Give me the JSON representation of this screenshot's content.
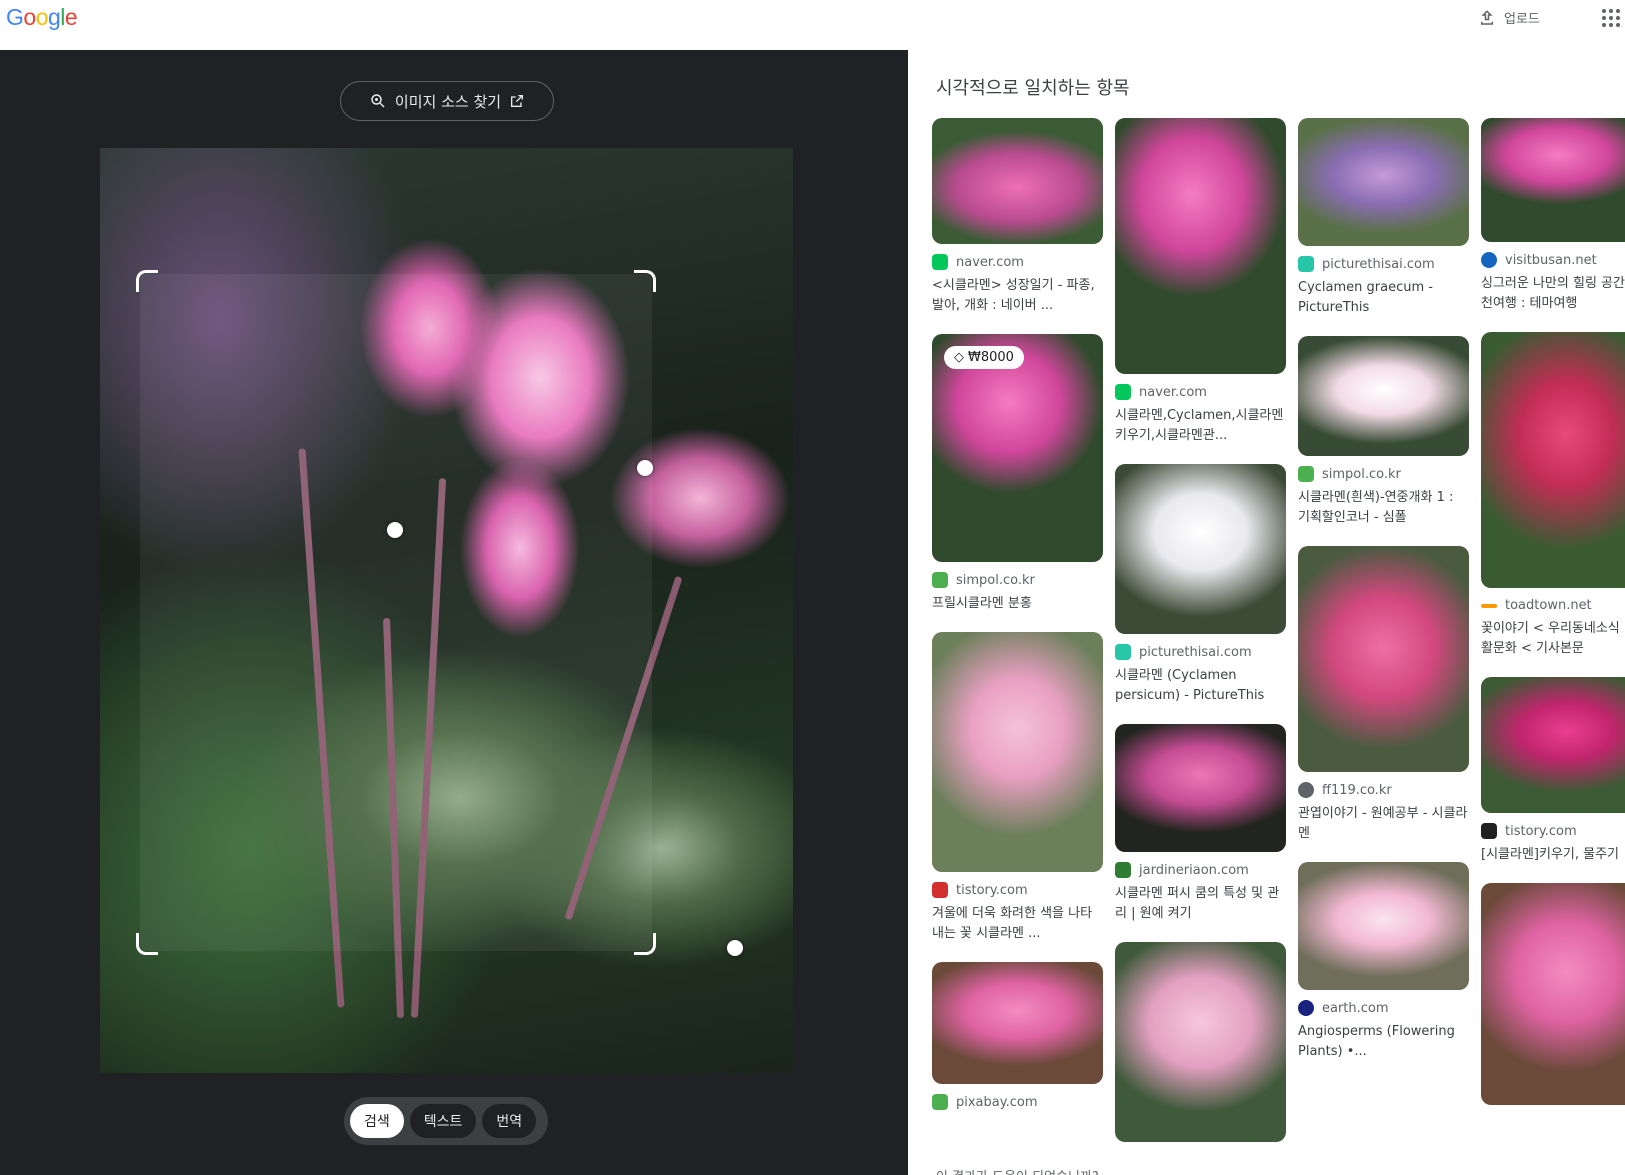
{
  "header": {
    "logo_text": "Google",
    "upload_label": "업로드"
  },
  "lens": {
    "source_button_label": "이미지 소스 찾기",
    "modes": [
      "검색",
      "텍스트",
      "번역"
    ],
    "active_mode": "검색"
  },
  "results": {
    "title": "시각적으로 일치하는 항목",
    "feedback": "이 결과가 도움이 되었습니까?",
    "columns": [
      [
        {
          "source": "naver.com",
          "title": "<시클라멘> 성장일기 - 파종, 발아, 개화 : 네이버 ...",
          "favicon_color": "#03c75a",
          "theme": "g1"
        },
        {
          "source": "simpol.co.kr",
          "title": "프릴시클라멘 분홍",
          "favicon_color": "#4caf50",
          "theme": "g2",
          "price": "₩8000"
        },
        {
          "source": "tistory.com",
          "title": "겨울에 더욱 화려한 색을 나타내는 꽃 시클라멘 ...",
          "favicon_color": "#d32f2f",
          "theme": "g6"
        },
        {
          "source": "pixabay.com",
          "title": "",
          "favicon_color": "#4caf50",
          "theme": "g13"
        }
      ],
      [
        {
          "source": "naver.com",
          "title": "시클라멘,Cyclamen,시클라멘키우기,시클라멘관...",
          "favicon_color": "#03c75a",
          "theme": "g2"
        },
        {
          "source": "picturethisai.com",
          "title": "시클라멘 (Cyclamen persicum) - PictureThis",
          "favicon_color": "#26c6a6",
          "theme": "g4"
        },
        {
          "source": "jardineriaon.com",
          "title": "시클라멘 퍼시 쿰의 특성 및 관리 | 원예 켜기",
          "favicon_color": "#2e7d32",
          "theme": "g5"
        },
        {
          "source": "",
          "title": "",
          "favicon_color": "#ffffff",
          "theme": "g9"
        }
      ],
      [
        {
          "source": "picturethisai.com",
          "title": "Cyclamen graecum - PictureThis",
          "favicon_color": "#26c6a6",
          "theme": "g3"
        },
        {
          "source": "simpol.co.kr",
          "title": "시클라멘(흰색)-연중개화 1 : 기획할인코너 - 심폴",
          "favicon_color": "#4caf50",
          "theme": "g8"
        },
        {
          "source": "ff119.co.kr",
          "title": "관엽이야기 - 원예공부 - 시클라멘",
          "favicon_color": "#5f6368",
          "theme": "g7"
        },
        {
          "source": "earth.com",
          "title": "Angiosperms (Flowering Plants) •...",
          "favicon_color": "#1a237e",
          "theme": "g10"
        }
      ],
      [
        {
          "source": "visitbusan.net",
          "title": "싱그러운 나만의 힐링 공간: 주천여행 : 테마여행",
          "favicon_color": "#1565c0",
          "theme": "g2"
        },
        {
          "source": "toadtown.net",
          "title": "꽃이야기 < 우리동네소식 < 생활문화 < 기사본문",
          "favicon_color": "#ff9800",
          "theme": "g11"
        },
        {
          "source": "tistory.com",
          "title": "[시클라멘]키우기, 물주기",
          "favicon_color": "#212121",
          "theme": "g12"
        },
        {
          "source": "",
          "title": "",
          "favicon_color": "#ffffff",
          "theme": "g13"
        }
      ]
    ]
  }
}
